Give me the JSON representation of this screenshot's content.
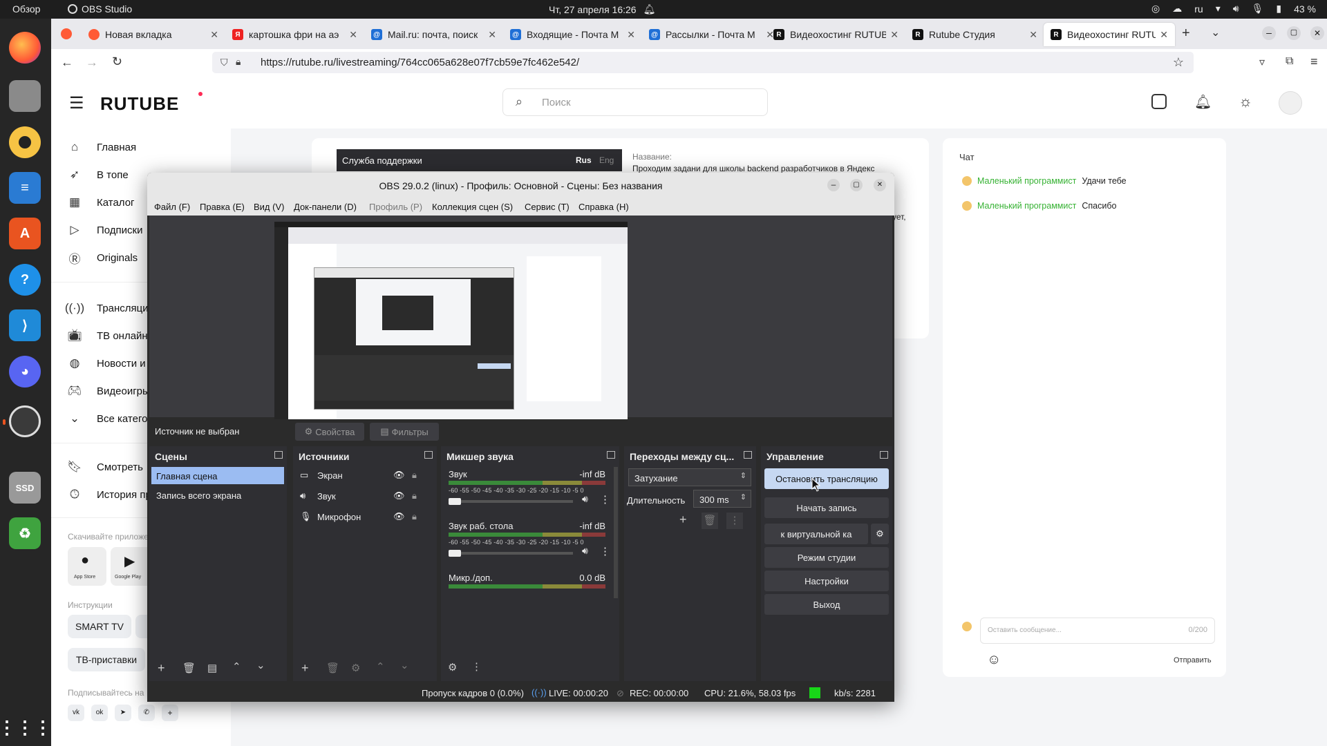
{
  "topbar": {
    "overview": "Обзор",
    "app_name": "OBS Studio",
    "datetime": "Чт, 27 апреля  16:26",
    "lang": "ru",
    "battery": "43 %"
  },
  "browser": {
    "tabs": [
      {
        "label": "Новая вкладка",
        "fav_color": "#ff5a36"
      },
      {
        "label": "картошка фри на аэ",
        "fav_color": "#e22"
      },
      {
        "label": "Mail.ru: почта, поиск",
        "fav_color": "#1f6fd6"
      },
      {
        "label": "Входящие - Почта М",
        "fav_color": "#1f6fd6"
      },
      {
        "label": "Рассылки - Почта М",
        "fav_color": "#1f6fd6"
      },
      {
        "label": "Видеохостинг RUTUB",
        "fav_color": "#111"
      },
      {
        "label": "Rutube Студия",
        "fav_color": "#111"
      },
      {
        "label": "Видеохостинг RUTUB",
        "fav_color": "#111"
      }
    ],
    "url": "https://rutube.ru/livestreaming/764cc065a628e07f7cb59e7fc462e542/"
  },
  "rutube": {
    "logo": "RUTUBE",
    "search_placeholder": "Поиск",
    "sidebar": [
      {
        "icon": "home-icon",
        "label": "Главная"
      },
      {
        "icon": "rocket-icon",
        "label": "В топе"
      },
      {
        "icon": "grid-icon",
        "label": "Каталог"
      },
      {
        "icon": "subscriptions-icon",
        "label": "Подписки"
      },
      {
        "icon": "originals-icon",
        "label": "Originals"
      },
      {
        "icon": "broadcast-icon",
        "label": "Трансляции"
      },
      {
        "icon": "tv-icon",
        "label": "ТВ онлайн"
      },
      {
        "icon": "globe-icon",
        "label": "Новости и"
      },
      {
        "icon": "gamepad-icon",
        "label": "Видеоигры"
      },
      {
        "icon": "chevron-down-icon",
        "label": "Все катего"
      },
      {
        "icon": "bookmark-icon",
        "label": "Смотреть"
      },
      {
        "icon": "history-icon",
        "label": "История пр"
      }
    ],
    "download_app": "Скачивайте приложе",
    "app_store": "App Store",
    "google_play": "Google Play",
    "instructions": "Инструкции",
    "smart_tv": "SMART TV",
    "tv_boxes": "ТВ-приставки",
    "subscribe": "Подписывайтесь на",
    "support": {
      "title": "Служба поддержки",
      "lang1": "Rus",
      "lang2": "Eng"
    },
    "name_label": "Название:",
    "name_value": "Проходим задани для школы backend разработчиков в Яндекс",
    "partial_text": "ует,",
    "chat": {
      "title": "Чат",
      "messages": [
        {
          "author": "Маленький программист",
          "text": "Удачи тебе"
        },
        {
          "author": "Маленький программист",
          "text": "Спасибо"
        }
      ],
      "input_placeholder": "Оставить сообщение...",
      "counter": "0/200",
      "send": "Отправить"
    }
  },
  "obs": {
    "title": "OBS 29.0.2 (linux) - Профиль: Основной - Сцены: Без названия",
    "menu": [
      "Файл (F)",
      "Правка (E)",
      "Вид (V)",
      "Док-панели (D)",
      "Профиль (P)",
      "Коллекция сцен (S)",
      "Сервис (T)",
      "Справка (H)"
    ],
    "source_bar": {
      "none": "Источник не выбран",
      "properties": "Свойства",
      "filters": "Фильтры"
    },
    "scenes": {
      "title": "Сцены",
      "items": [
        "Главная сцена",
        "Запись всего экрана"
      ]
    },
    "sources": {
      "title": "Источники",
      "items": [
        {
          "icon": "monitor-icon",
          "label": "Экран"
        },
        {
          "icon": "speaker-icon",
          "label": "Звук"
        },
        {
          "icon": "microphone-icon",
          "label": "Микрофон"
        }
      ]
    },
    "mixer": {
      "title": "Микшер звука",
      "ticks": "-60 -55 -50 -45 -40 -35 -30 -25 -20 -15 -10  -5   0",
      "channels": [
        {
          "name": "Звук",
          "level": "-inf dB"
        },
        {
          "name": "Звук раб. стола",
          "level": "-inf dB"
        },
        {
          "name": "Микр./доп.",
          "level": "0.0 dB"
        }
      ]
    },
    "transitions": {
      "title": "Переходы между сц...",
      "type": "Затухание",
      "duration_label": "Длительность",
      "duration_value": "300 ms"
    },
    "controls": {
      "title": "Управление",
      "stop_stream": "Остановить трансляцию",
      "start_record": "Начать запись",
      "virtual_cam": "к виртуальной ка",
      "studio_mode": "Режим студии",
      "settings": "Настройки",
      "exit": "Выход"
    },
    "status": {
      "dropped": "Пропуск кадров 0 (0.0%)",
      "live": "LIVE: 00:00:20",
      "rec": "REC: 00:00:00",
      "cpu": "CPU: 21.6%, 58.03 fps",
      "kbs": "kb/s: 2281"
    }
  }
}
